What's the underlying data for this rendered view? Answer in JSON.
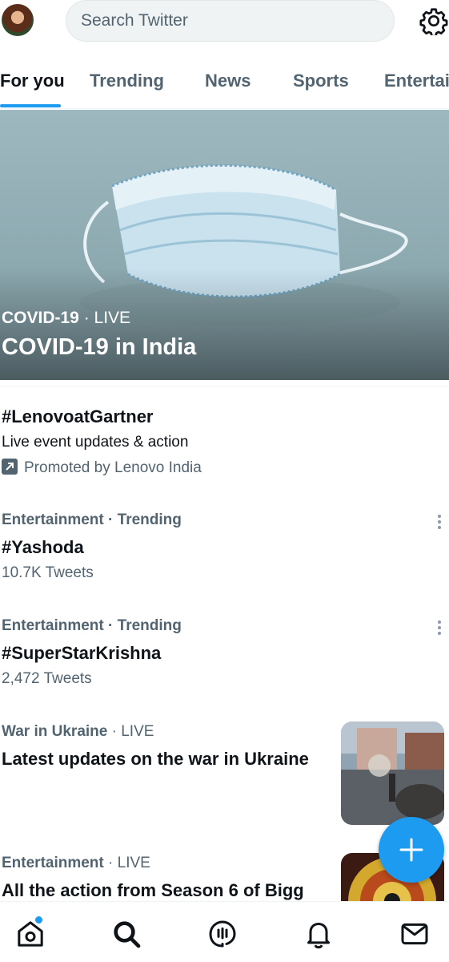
{
  "search": {
    "placeholder": "Search Twitter"
  },
  "tabs": [
    {
      "label": "For you",
      "active": true
    },
    {
      "label": "Trending"
    },
    {
      "label": "News"
    },
    {
      "label": "Sports"
    },
    {
      "label": "Entertainment"
    }
  ],
  "hero": {
    "category": "COVID-19",
    "separator": " · ",
    "status": "LIVE",
    "title": "COVID-19 in India"
  },
  "promoted": {
    "name": "#LenovoatGartner",
    "description": "Live event updates & action",
    "promoted_by": "Promoted by Lenovo India"
  },
  "trends": [
    {
      "category": "Entertainment",
      "separator": " · ",
      "context": "Trending",
      "name": "#Yashoda",
      "count": "10.7K Tweets"
    },
    {
      "category": "Entertainment",
      "separator": " · ",
      "context": "Trending",
      "name": "#SuperStarKrishna",
      "count": "2,472 Tweets"
    }
  ],
  "live_items": [
    {
      "category": "War in Ukraine",
      "separator": " · ",
      "status": "LIVE",
      "title": "Latest updates on the war in Ukraine"
    },
    {
      "category": "Entertainment",
      "separator": " · ",
      "status": "LIVE",
      "title": "All the action from Season 6 of Bigg"
    }
  ],
  "icons": {
    "settings": "gear-icon",
    "compose": "plus-icon",
    "nav": [
      "home-icon",
      "search-icon",
      "spaces-icon",
      "bell-icon",
      "mail-icon"
    ]
  },
  "colors": {
    "accent": "#1d9bf0",
    "text": "#0f1419",
    "secondary": "#536471"
  }
}
